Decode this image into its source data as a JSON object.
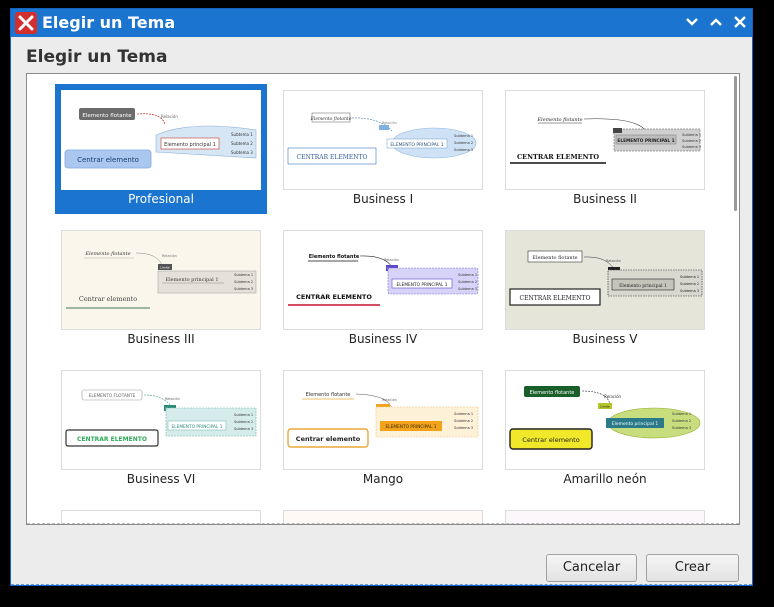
{
  "window": {
    "title": "Elegir un Tema",
    "controls": [
      "minimize-icon",
      "maximize-icon",
      "close-icon"
    ],
    "accent": "#1b75d0"
  },
  "dialog": {
    "heading": "Elegir un Tema",
    "themes": [
      {
        "name": "Profesional",
        "selected": true
      },
      {
        "name": "Business I",
        "selected": false
      },
      {
        "name": "Business II",
        "selected": false
      },
      {
        "name": "Business III",
        "selected": false
      },
      {
        "name": "Business IV",
        "selected": false
      },
      {
        "name": "Business V",
        "selected": false
      },
      {
        "name": "Business VI",
        "selected": false
      },
      {
        "name": "Mango",
        "selected": false
      },
      {
        "name": "Amarillo neón",
        "selected": false
      }
    ],
    "previews": {
      "profesional": {
        "float": "Elemento flotante",
        "rel": "Relación",
        "main": "Elemento principal 1",
        "central": "Centrar elemento",
        "subs": [
          "Subtema 1",
          "Subtema 2",
          "Subtema 3"
        ]
      },
      "business1": {
        "float": "Elemento flotante",
        "rel": "Relación",
        "main": "ELEMENTO PRINCIPAL 1",
        "central": "CENTRAR ELEMENTO",
        "subs": [
          "Subtema 1",
          "Subtema 2",
          "Subtema 3"
        ]
      },
      "business2": {
        "float": "Elemento flotante",
        "main": "ELEMENTO PRINCIPAL 1",
        "central": "CENTRAR ELEMENTO",
        "subs": [
          "Subtema 1",
          "Subtema 2",
          "Subtema 3"
        ]
      },
      "business3": {
        "float": "Elemento flotante",
        "rel": "Relación",
        "tag": "Límite",
        "main": "Elemento principal 1",
        "central": "Centrar elemento",
        "subs": [
          "Subtema 1",
          "Subtema 2",
          "Subtema 3"
        ]
      },
      "business4": {
        "float": "Elemento flotante",
        "rel": "Relación",
        "tag": "Límite",
        "main": "ELEMENTO PRINCIPAL 1",
        "central": "CENTRAR ELEMENTO",
        "subs": [
          "Subtema 1",
          "Subtema 2",
          "Subtema 3"
        ]
      },
      "business5": {
        "float": "Elemento flotante",
        "rel": "Relación",
        "tag": "Límite",
        "main": "Elemento principal 1",
        "central": "CENTRAR ELEMENTO",
        "subs": [
          "Subtema 1",
          "Subtema 2",
          "Subtema 3"
        ]
      },
      "business6": {
        "float": "ELEMENTO FLOTANTE",
        "rel": "Relación",
        "tag": "Límite",
        "main": "ELEMENTO PRINCIPAL 1",
        "central": "CENTRAR ELEMENTO",
        "subs": [
          "Subtema 1",
          "Subtema 2",
          "Subtema 3"
        ]
      },
      "mango": {
        "float": "Elemento flotante",
        "rel": "Relación",
        "tag": "Límite",
        "main": "ELEMENTO PRINCIPAL 1",
        "central": "Centrar elemento",
        "subs": [
          "Subtema 1",
          "Subtema 2",
          "Subtema 3"
        ]
      },
      "neon": {
        "float": "Elemento flotante",
        "rel": "Relación",
        "tag": "Límite",
        "main": "Elemento principal 1",
        "central": "Centrar elemento",
        "subs": [
          "Subtema 1",
          "Subtema 2",
          "Subtema 3"
        ]
      }
    }
  },
  "buttons": {
    "cancel": "Cancelar",
    "create": "Crear"
  }
}
